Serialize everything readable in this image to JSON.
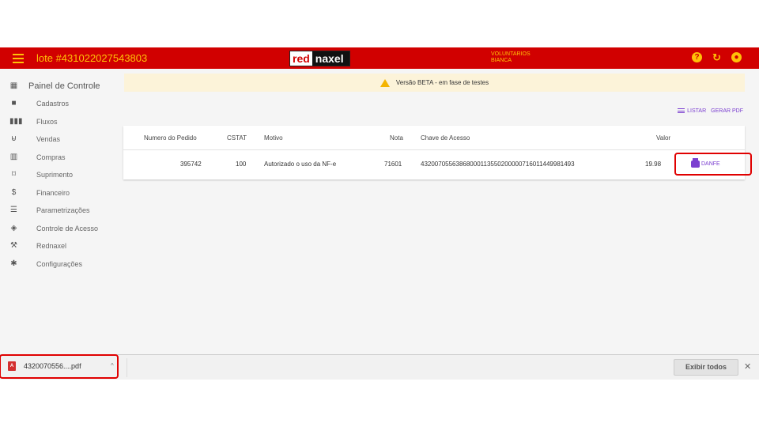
{
  "header": {
    "title": "lote #431022027543803",
    "brand_red": "red",
    "brand_dark": "naxel",
    "user_line1": "VOLUNTARIOS",
    "user_line2": "BIANCA",
    "help_icon": "help-icon",
    "refresh_icon": "refresh-icon",
    "account_icon": "account-icon"
  },
  "sidebar": {
    "items": [
      {
        "label": "Painel de Controle",
        "icon": "dashboard-icon"
      },
      {
        "label": "Cadastros",
        "icon": "folder-icon"
      },
      {
        "label": "Fluxos",
        "icon": "columns-icon"
      },
      {
        "label": "Vendas",
        "icon": "cart-icon"
      },
      {
        "label": "Compras",
        "icon": "store-icon"
      },
      {
        "label": "Suprimento",
        "icon": "crop-icon"
      },
      {
        "label": "Financeiro",
        "icon": "money-icon"
      },
      {
        "label": "Parametrizações",
        "icon": "sliders-icon"
      },
      {
        "label": "Controle de Acesso",
        "icon": "shield-icon"
      },
      {
        "label": "Rednaxel",
        "icon": "wrench-icon"
      },
      {
        "label": "Configurações",
        "icon": "gear-icon"
      }
    ]
  },
  "banner": {
    "text": "Versão BETA - em fase de testes"
  },
  "actions": {
    "list": "LISTAR",
    "pdf": "GERAR PDF"
  },
  "table": {
    "columns": [
      "Numero do Pedido",
      "CSTAT",
      "Motivo",
      "Nota",
      "Chave de Acesso",
      "Valor"
    ],
    "rows": [
      {
        "pedido": "395742",
        "cstat": "100",
        "motivo": "Autorizado o uso da NF-e",
        "nota": "71601",
        "chave": "43200705563868000113550200000716011449981493",
        "valor": "19.98",
        "action": "DANFE"
      }
    ]
  },
  "downloads": {
    "file_name": "4320070556....pdf",
    "show_all": "Exibir todos",
    "close": "✕",
    "chevron": "^"
  },
  "colors": {
    "topbar": "#d10000",
    "accent": "#ffc107",
    "link": "#7b3fd0",
    "highlight": "#e00000"
  }
}
